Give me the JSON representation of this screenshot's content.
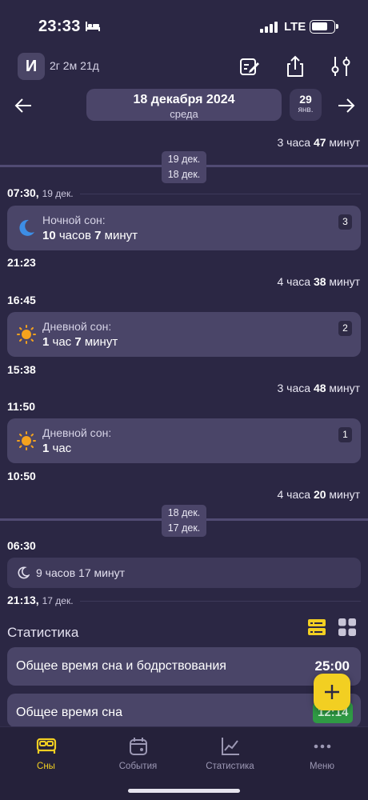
{
  "status": {
    "time": "23:33",
    "network": "LTE",
    "battery_level": 0.7
  },
  "header": {
    "avatar_letter": "И",
    "age": "2г 2м 21д"
  },
  "date_nav": {
    "date": "18 декабря 2024",
    "weekday": "среда",
    "next_day": "29",
    "next_month": "янв."
  },
  "timeline": {
    "top_gap": {
      "pre": "3 часа ",
      "bold": "47",
      "post": " минут"
    },
    "sep1": {
      "a": "19 дек.",
      "b": "18 дек."
    },
    "t1": "07:30,",
    "t1_small": "19 дек.",
    "card1": {
      "title": "Ночной сон:",
      "d1": "10",
      "u1": " часов ",
      "d2": "7",
      "u2": " минут",
      "badge": "3",
      "icon": "moon-icon"
    },
    "t2": "21:23",
    "gap2": {
      "pre": "4 часа ",
      "bold": "38",
      "post": " минут"
    },
    "t3": "16:45",
    "card2": {
      "title": "Дневной сон:",
      "d1": "1",
      "u1": " час ",
      "d2": "7",
      "u2": " минут",
      "badge": "2",
      "icon": "sun-icon"
    },
    "t4": "15:38",
    "gap3": {
      "pre": "3 часа ",
      "bold": "48",
      "post": " минут"
    },
    "t5": "11:50",
    "card3": {
      "title": "Дневной сон:",
      "d1": "1",
      "u1": " час",
      "badge": "1",
      "icon": "sun-icon"
    },
    "t6": "10:50",
    "gap4": {
      "pre": "4 часа ",
      "bold": "20",
      "post": " минут"
    },
    "sep2": {
      "a": "18 дек.",
      "b": "17 дек."
    },
    "t7": "06:30",
    "mini": {
      "text": "9 часов 17 минут"
    },
    "t8": "21:13,",
    "t8_small": "17 дек."
  },
  "stats": {
    "title": "Статистика",
    "items": [
      {
        "label": "Общее время сна и бодрствования",
        "value": "25:00"
      },
      {
        "label": "Общее время сна",
        "value": "12:14"
      }
    ]
  },
  "tabs": [
    {
      "label": "Сны",
      "icon": "bed-icon"
    },
    {
      "label": "События",
      "icon": "calendar-icon"
    },
    {
      "label": "Статистика",
      "icon": "chart-icon"
    },
    {
      "label": "Меню",
      "icon": "dots-icon"
    }
  ],
  "colors": {
    "accent": "#f2cf22",
    "background": "#2b2744",
    "card": "#4a4568",
    "green": "#2f9a44"
  }
}
